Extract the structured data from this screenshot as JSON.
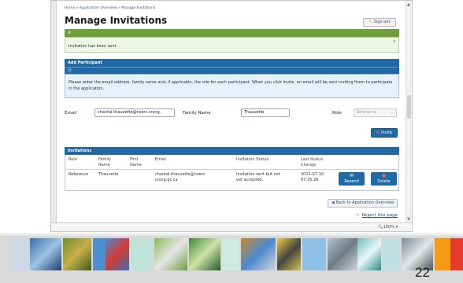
{
  "breadcrumb": "Home » Application Overview » Manage Invitations",
  "page_title": "Manage Invitations",
  "sign_out_label": "Sign out",
  "alert": {
    "bar_icon": "⊘",
    "message": "Invitation has been sent.",
    "close": "×"
  },
  "add_participant": {
    "header": "Add Participant",
    "info_icon": "⓪",
    "instructions": "Please enter the email address, family name and, if applicable, the role for each participant. When you click Invite, an email will be sent inviting them to participate in the application."
  },
  "form": {
    "email_label": "Email",
    "email_value": "chantal.thauvette@nserc-crsng.",
    "family_label": "Family Name",
    "family_value": "Thauvette",
    "role_label": "Role",
    "role_value": "Reference",
    "invite_label": "Invite"
  },
  "invitations": {
    "header": "Invitations",
    "columns": [
      "Role",
      "Family\nName",
      "First\nName",
      "Email",
      "Invitation Status",
      "Last Status\nChange"
    ],
    "rows": [
      {
        "role": "Reference",
        "family": "Thauvette",
        "first": "",
        "email": "chantal.thauvette@nserc-\ncrsng.gc.ca",
        "status": "Invitation sent but not\nyet accepted.",
        "last_change": "2015-07-10\n07:35:26",
        "resend_label": "Resend",
        "delete_label": "Delete"
      }
    ]
  },
  "back_label": "Back to Application Overview",
  "report_label": "Report this page",
  "zoom_text": "🔍100% ▾",
  "slide_number": "22",
  "colors": {
    "primary_blue": "#1f6aa5",
    "success_green": "#6da03a",
    "footer_orange": "#f39c12",
    "footer_red": "#e63c2e"
  }
}
